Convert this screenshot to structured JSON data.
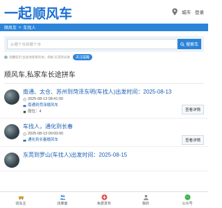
{
  "header": {
    "logo_part1": "一起",
    "logo_part2": "顺风车",
    "city_label": "城市",
    "login_label": "登录"
  },
  "breadcrumb": {
    "home": "顺风车",
    "separator": "»",
    "current": "车找人"
  },
  "search": {
    "placeholder": "从哪个市到哪个市",
    "button_label": "搜索车",
    "hint": "温馨提示:出发地到目的地，例如:东莞到长春",
    "follow_label": "关注提醒"
  },
  "section_title": "顺风车,私家车长途拼车",
  "listings": [
    {
      "title": "南通、太仓、苏州到菏泽东明(车找人)出发时间：2025-08-13",
      "time": "2025-08-13 08:41:00",
      "source": "南通到菏泽顺风车",
      "seats": "座位：4",
      "detail_label": "查看详情"
    },
    {
      "title": "车找人，通化到长春",
      "time": "2025-08-13 00:00:00",
      "source": "通化到长春顺风车",
      "seats": "",
      "detail_label": "查看详情"
    },
    {
      "title": "东莞到罗山(车找人)出发时间：2025-08-15",
      "time": "",
      "source": "",
      "seats": "",
      "detail_label": ""
    }
  ],
  "bottom_nav": [
    {
      "label": "找车主",
      "icon": "car-icon"
    },
    {
      "label": "找乘客",
      "icon": "people-icon"
    },
    {
      "label": "免费发布",
      "icon": "plus-icon"
    },
    {
      "label": "我的",
      "icon": "user-icon"
    },
    {
      "label": "公众号",
      "icon": "wechat-icon"
    }
  ],
  "colors": {
    "brand": "#1a6fd0",
    "bar": "#2b84d9",
    "link": "#1a5fb4"
  }
}
